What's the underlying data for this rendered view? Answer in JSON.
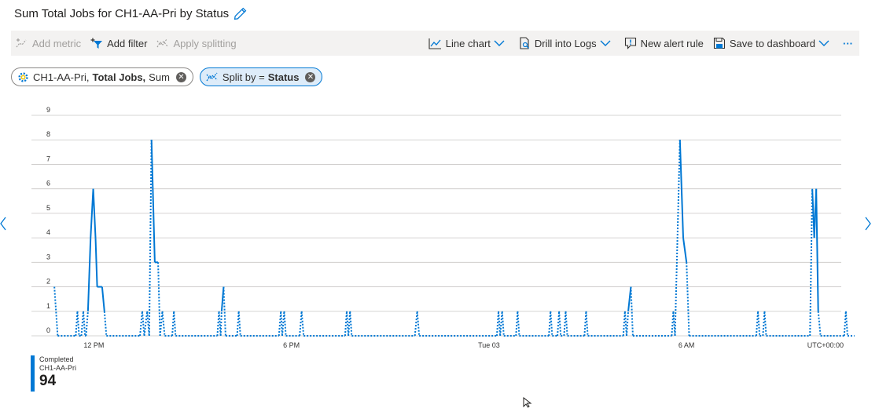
{
  "header": {
    "title": "Sum Total Jobs for CH1-AA-Pri by Status",
    "edit_icon": "pencil-icon"
  },
  "toolbar": {
    "add_metric": "Add metric",
    "add_filter": "Add filter",
    "apply_splitting": "Apply splitting",
    "line_chart": "Line chart",
    "drill_into_logs": "Drill into Logs",
    "new_alert_rule": "New alert rule",
    "save_to_dashboard": "Save to dashboard",
    "more": "···"
  },
  "pills": {
    "metric_resource": "CH1-AA-Pri,",
    "metric_name": "Total Jobs,",
    "metric_agg": "Sum",
    "split_prefix": "Split by =",
    "split_value": "Status"
  },
  "colors": {
    "accent": "#0078d4",
    "grid": "#c8c6c4",
    "toolbar_bg": "#f3f2f1"
  },
  "chart_data": {
    "type": "line",
    "title": "Sum Total Jobs for CH1-AA-Pri by Status",
    "yticks": [
      0,
      1,
      2,
      3,
      4,
      5,
      6,
      7,
      8,
      9
    ],
    "ylim": [
      0,
      9
    ],
    "xlim_hours": [
      10.82,
      34.7
    ],
    "x_units": "hours since Mon 00:00 (UTC+00:00)",
    "xticks": [
      {
        "label": "12 PM",
        "hour": 12
      },
      {
        "label": "6 PM",
        "hour": 18
      },
      {
        "label": "Tue 03",
        "hour": 24
      },
      {
        "label": "6 AM",
        "hour": 30
      }
    ],
    "timezone_label": "UTC+00:00",
    "grid": true,
    "series": [
      {
        "name": "Completed",
        "resource": "CH1-AA-Pri",
        "total": "94",
        "color": "#0078d4",
        "points": [
          [
            10.8,
            2
          ],
          [
            10.9,
            0
          ],
          [
            11.45,
            0
          ],
          [
            11.5,
            1
          ],
          [
            11.55,
            0
          ],
          [
            11.62,
            0
          ],
          [
            11.68,
            1
          ],
          [
            11.73,
            0
          ],
          [
            11.76,
            0
          ],
          [
            11.82,
            1
          ],
          [
            11.9,
            4
          ],
          [
            11.98,
            6
          ],
          [
            12.05,
            4
          ],
          [
            12.1,
            2
          ],
          [
            12.25,
            2
          ],
          [
            12.32,
            1
          ],
          [
            12.38,
            0
          ],
          [
            13.4,
            0
          ],
          [
            13.47,
            1
          ],
          [
            13.53,
            0
          ],
          [
            13.62,
            1
          ],
          [
            13.68,
            0
          ],
          [
            13.75,
            8
          ],
          [
            13.85,
            3
          ],
          [
            13.95,
            3
          ],
          [
            14.01,
            0
          ],
          [
            14.08,
            1
          ],
          [
            14.15,
            0
          ],
          [
            14.38,
            0
          ],
          [
            14.43,
            1
          ],
          [
            14.48,
            0
          ],
          [
            15.75,
            0
          ],
          [
            15.8,
            1
          ],
          [
            15.85,
            0
          ],
          [
            15.88,
            1
          ],
          [
            15.94,
            2
          ],
          [
            16.0,
            0
          ],
          [
            16.35,
            0
          ],
          [
            16.4,
            1
          ],
          [
            16.45,
            0
          ],
          [
            17.62,
            0
          ],
          [
            17.68,
            1
          ],
          [
            17.72,
            0
          ],
          [
            17.78,
            1
          ],
          [
            17.83,
            0
          ],
          [
            18.25,
            0
          ],
          [
            18.31,
            1
          ],
          [
            18.37,
            0
          ],
          [
            19.63,
            0
          ],
          [
            19.68,
            1
          ],
          [
            19.73,
            0
          ],
          [
            19.78,
            1
          ],
          [
            19.83,
            0
          ],
          [
            21.75,
            0
          ],
          [
            21.82,
            1
          ],
          [
            21.88,
            0
          ],
          [
            24.24,
            0
          ],
          [
            24.29,
            1
          ],
          [
            24.34,
            0
          ],
          [
            24.4,
            1
          ],
          [
            24.45,
            0
          ],
          [
            24.82,
            0
          ],
          [
            24.87,
            1
          ],
          [
            24.92,
            0
          ],
          [
            25.82,
            0
          ],
          [
            25.87,
            1
          ],
          [
            25.92,
            0
          ],
          [
            26.08,
            0
          ],
          [
            26.13,
            1
          ],
          [
            26.18,
            0
          ],
          [
            26.28,
            0
          ],
          [
            26.33,
            1
          ],
          [
            26.38,
            0
          ],
          [
            26.9,
            0
          ],
          [
            26.95,
            1
          ],
          [
            27.0,
            0
          ],
          [
            28.08,
            0
          ],
          [
            28.13,
            1
          ],
          [
            28.18,
            0
          ],
          [
            28.23,
            1
          ],
          [
            28.31,
            2
          ],
          [
            28.37,
            0
          ],
          [
            29.55,
            0
          ],
          [
            29.6,
            1
          ],
          [
            29.65,
            0
          ],
          [
            29.8,
            8
          ],
          [
            29.9,
            4
          ],
          [
            30.0,
            3
          ],
          [
            30.08,
            0
          ],
          [
            32.12,
            0
          ],
          [
            32.17,
            1
          ],
          [
            32.22,
            0
          ],
          [
            32.32,
            0
          ],
          [
            32.37,
            1
          ],
          [
            32.42,
            0
          ],
          [
            33.75,
            0
          ],
          [
            33.82,
            6
          ],
          [
            33.88,
            4
          ],
          [
            33.94,
            6
          ],
          [
            34.0,
            1
          ],
          [
            34.07,
            0
          ],
          [
            34.79,
            0
          ],
          [
            34.84,
            1
          ],
          [
            34.89,
            0
          ],
          [
            35.1,
            0
          ]
        ]
      }
    ]
  }
}
